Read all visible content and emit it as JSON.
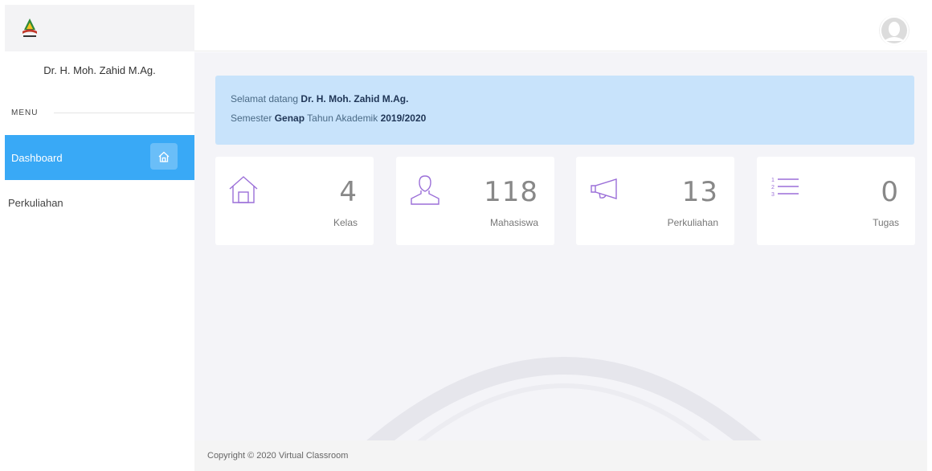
{
  "sidebar": {
    "logo_name": "logo-icon",
    "user_name": "Dr. H. Moh. Zahid M.Ag.",
    "menu_title": "MENU",
    "items": [
      {
        "label": "Dashboard",
        "icon": "home-icon",
        "active": true
      },
      {
        "label": "Perkuliahan",
        "active": false
      }
    ]
  },
  "header": {
    "avatar_icon": "user-avatar-icon"
  },
  "welcome": {
    "greeting_prefix": "Selamat datang",
    "user_name": "Dr. H. Moh. Zahid M.Ag.",
    "semester_prefix": "Semester",
    "semester": "Genap",
    "year_prefix": "Tahun Akademik",
    "year": "2019/2020"
  },
  "stats": [
    {
      "icon": "home-icon",
      "value": "4",
      "label": "Kelas"
    },
    {
      "icon": "user-icon",
      "value": "118",
      "label": "Mahasiswa"
    },
    {
      "icon": "megaphone-icon",
      "value": "13",
      "label": "Perkuliahan"
    },
    {
      "icon": "list-icon",
      "value": "0",
      "label": "Tugas"
    }
  ],
  "footer": {
    "copyright": "Copyright © 2020 Virtual Classroom"
  },
  "colors": {
    "accent": "#39a9f6",
    "icon_purple": "#9b6fd8",
    "welcome_bg": "#c8e3fb"
  }
}
